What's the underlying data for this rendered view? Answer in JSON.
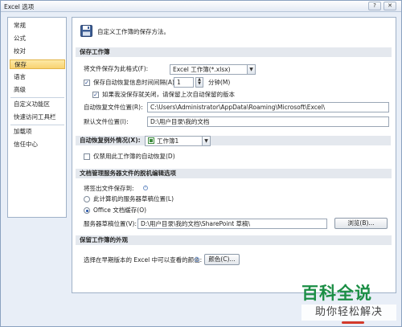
{
  "window": {
    "title": "Excel 选项",
    "help_glyph": "?",
    "close_glyph": "✕"
  },
  "sidebar": {
    "items": [
      {
        "label": "常规"
      },
      {
        "label": "公式"
      },
      {
        "label": "校对"
      },
      {
        "label": "保存",
        "active": true
      },
      {
        "label": "语言"
      },
      {
        "label": "高级"
      },
      {
        "label": "自定义功能区"
      },
      {
        "label": "快速访问工具栏"
      },
      {
        "label": "加载项"
      },
      {
        "label": "信任中心"
      }
    ]
  },
  "header": {
    "text": "自定义工作簿的保存方法。",
    "icon": "save-disk-icon"
  },
  "save_workbooks": {
    "title": "保存工作簿",
    "format_label": "将文件保存为此格式(F):",
    "format_value": "Excel 工作簿(*.xlsx)",
    "autorecover_label": "保存自动恢复信息时间间隔(A)",
    "autorecover_checked": true,
    "autorecover_minutes": "1",
    "minutes_unit": "分钟(M)",
    "keep_last_label": "如果我没保存就关闭，请保留上次自动保留的版本",
    "keep_last_checked": true,
    "autorecover_location_label": "自动恢复文件位置(R):",
    "autorecover_location_value": "C:\\Users\\Administrator\\AppData\\Roaming\\Microsoft\\Excel\\",
    "default_location_label": "默认文件位置(I):",
    "default_location_value": "D:\\用户目录\\我的文档"
  },
  "autorecover_exceptions": {
    "title": "自动恢复例外情况(X):",
    "workbook_value": "工作簿1",
    "disable_label": "仅禁用此工作簿的自动恢复(D)",
    "disable_checked": false
  },
  "offline_editing": {
    "title": "文档管理服务器文件的脱机编辑选项",
    "save_to_label": "将签出文件保存到:",
    "option_server": "此计算机的服务器草稿位置(L)",
    "option_office": "Office 文档缓存(O)",
    "selected": "office",
    "drafts_label": "服务器草稿位置(V):",
    "drafts_value": "D:\\用户目录\\我的文档\\SharePoint 草稿\\",
    "browse_label": "浏览(B)..."
  },
  "visual_appearance": {
    "title": "保留工作簿的外观",
    "colors_label": "选择在早期版本的 Excel 中可以查看的颜色:",
    "colors_button": "颜色(C)..."
  },
  "watermark": {
    "title": "百科全说",
    "subtitle": "助你轻松解决"
  },
  "colors": {
    "accent_green": "#1b8e45",
    "section_bg": "#e4e8ee",
    "active_item": "#f8d271"
  }
}
